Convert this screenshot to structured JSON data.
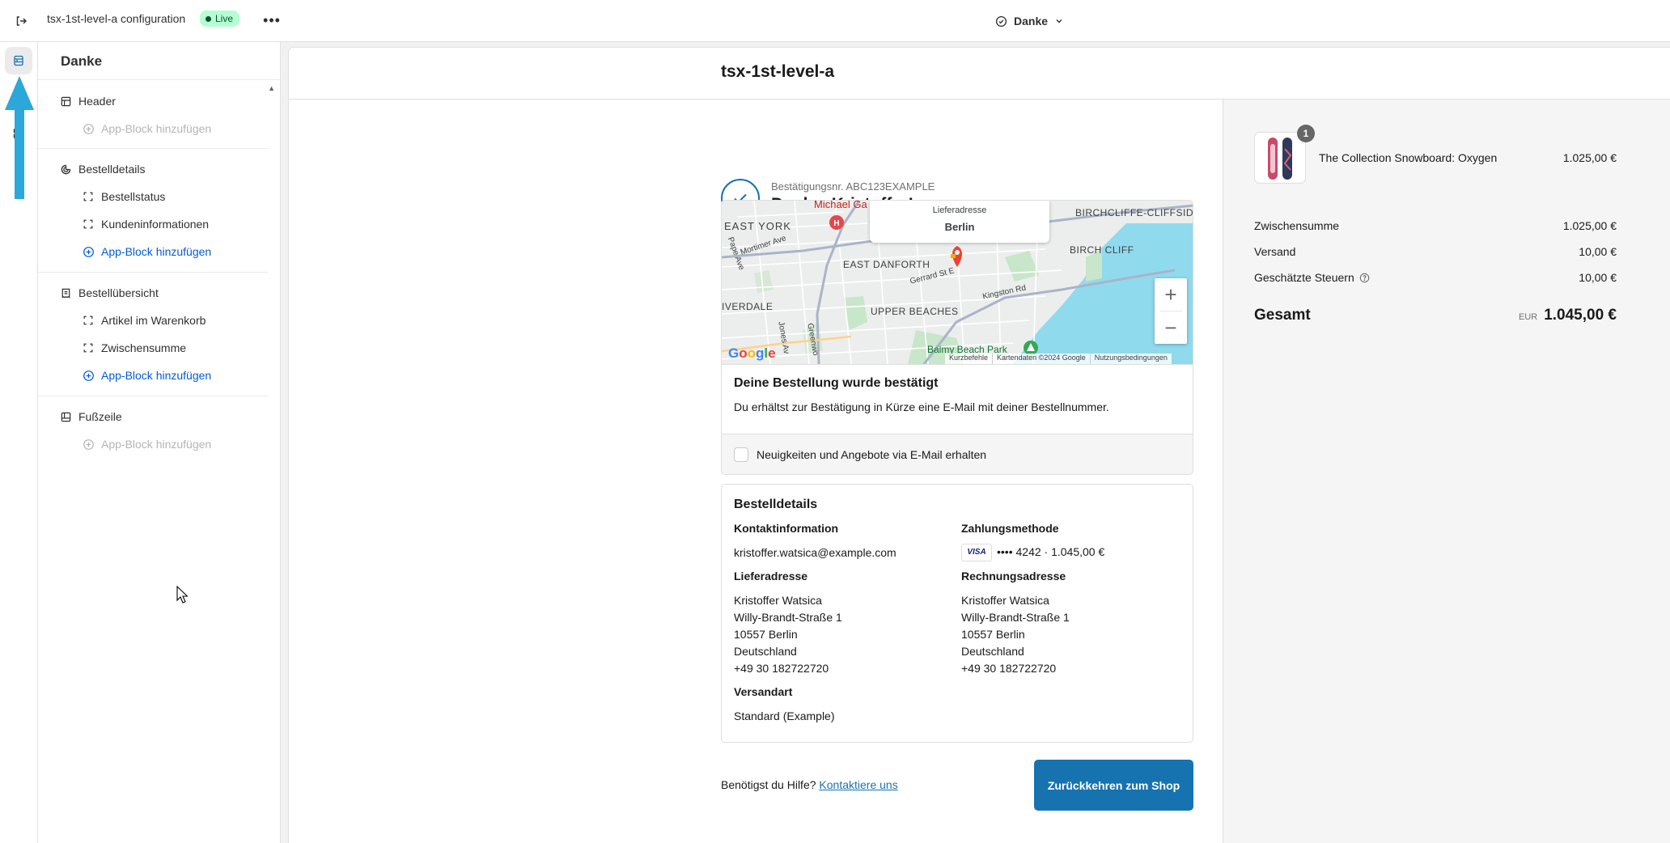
{
  "topbar": {
    "app_title": "tsx-1st-level-a configuration",
    "status_badge": "Live",
    "more_label": "•••",
    "page_selector": "Danke"
  },
  "sidebar": {
    "title": "Danke",
    "sections": [
      {
        "label": "Header",
        "icon": "header-icon",
        "items": [],
        "add_label": "App-Block hinzufügen",
        "add_enabled": false
      },
      {
        "label": "Bestelldetails",
        "icon": "order-details-icon",
        "items": [
          "Bestellstatus",
          "Kundeninformationen"
        ],
        "add_label": "App-Block hinzufügen",
        "add_enabled": true
      },
      {
        "label": "Bestellübersicht",
        "icon": "receipt-icon",
        "items": [
          "Artikel im Warenkorb",
          "Zwischensumme"
        ],
        "add_label": "App-Block hinzufügen",
        "add_enabled": true
      },
      {
        "label": "Fußzeile",
        "icon": "footer-icon",
        "items": [],
        "add_label": "App-Block hinzufügen",
        "add_enabled": false
      }
    ]
  },
  "preview": {
    "shop_name": "tsx-1st-level-a",
    "confirmation": {
      "number_label": "Bestätigungsnr. ABC123EXAMPLE",
      "thanks": "Danke, Kristoffer!"
    },
    "map": {
      "popup_label": "Lieferadresse",
      "popup_city": "Berlin",
      "labels": {
        "east_york": "EAST YORK",
        "michael": "Michael Ga",
        "birchcliffe": "BIRCHCLIFFE-CLIFFSIDE",
        "birch_cliff": "BIRCH CLIFF",
        "east_danforth": "EAST DANFORTH",
        "mortimer": "Mortimer Ave",
        "pape": "Pape Ave",
        "gerrard": "Gerrard St E",
        "kingston": "Kingston Rd",
        "riverdale": "IVERDALE",
        "upper_beaches": "UPPER BEACHES",
        "jones": "Jones Av",
        "greenwood": "Greenwo",
        "balmy": "Balmy Beach Park"
      },
      "google": "Google",
      "attrib": [
        "Kurzbefehle",
        "Kartendaten ©2024 Google",
        "Nutzungsbedingungen"
      ],
      "zoom_in": "+",
      "zoom_out": "−"
    },
    "status_card": {
      "heading": "Deine Bestellung wurde bestätigt",
      "text": "Du erhältst zur Bestätigung in Kürze eine E-Mail mit deiner Bestellnummer.",
      "newsletter": "Neuigkeiten und Angebote via E-Mail erhalten"
    },
    "details": {
      "heading": "Bestelldetails",
      "contact_label": "Kontaktinformation",
      "contact_email": "kristoffer.watsica@example.com",
      "shipping_address_label": "Lieferadresse",
      "shipping_address": [
        "Kristoffer Watsica",
        "Willy-Brandt-Straße 1",
        "10557 Berlin",
        "Deutschland",
        "+49 30 182722720"
      ],
      "shipping_method_label": "Versandart",
      "shipping_method": "Standard (Example)",
      "payment_label": "Zahlungsmethode",
      "card_brand": "VISA",
      "payment_value": "•••• 4242 · 1.045,00 €",
      "billing_address_label": "Rechnungsadresse",
      "billing_address": [
        "Kristoffer Watsica",
        "Willy-Brandt-Straße 1",
        "10557 Berlin",
        "Deutschland",
        "+49 30 182722720"
      ]
    },
    "help_text": "Benötigst du Hilfe?",
    "help_link": "Kontaktiere uns",
    "return_button": "Zurückkehren zum Shop",
    "summary": {
      "item_qty": "1",
      "item_name": "The Collection Snowboard: Oxygen",
      "item_price": "1.025,00 €",
      "subtotal_label": "Zwischensumme",
      "subtotal": "1.025,00 €",
      "shipping_label": "Versand",
      "shipping": "10,00 €",
      "tax_label": "Geschätzte Steuern",
      "tax": "10,00 €",
      "total_label": "Gesamt",
      "currency": "EUR",
      "total": "1.045,00 €"
    }
  },
  "colors": {
    "accent": "#1773b0",
    "link": "#005bd3",
    "live_badge": "#b4fed2",
    "annotation_arrow": "#2ba7d9"
  }
}
